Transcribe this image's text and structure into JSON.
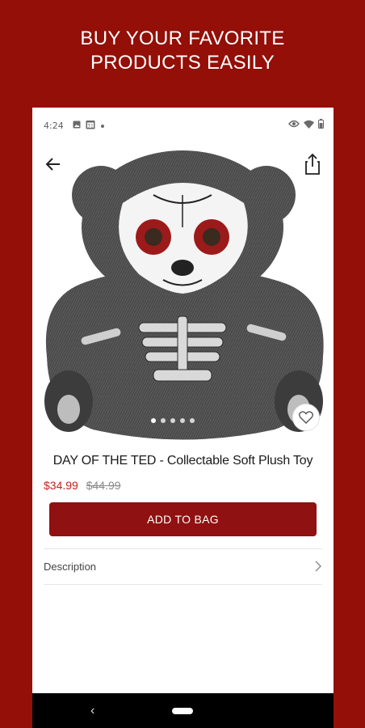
{
  "headline": {
    "line1": "BUY YOUR FAVORITE",
    "line2": "PRODUCTS EASILY"
  },
  "status_bar": {
    "time": "4:24",
    "icons": [
      "gallery-icon",
      "calendar-icon",
      "dot-icon",
      "eye-icon",
      "wifi-icon",
      "battery-icon"
    ]
  },
  "toolbar": {
    "back_icon": "arrow-left-icon",
    "share_icon": "share-icon"
  },
  "product": {
    "image_subject": "day-of-the-dead-teddy-bear",
    "title": "DAY OF THE TED - Collectable Soft Plush Toy",
    "sale_price": "$34.99",
    "original_price": "$44.99",
    "image_count": 5,
    "active_image_index": 0
  },
  "actions": {
    "add_to_bag_label": "ADD TO BAG",
    "favorite_icon": "heart-icon"
  },
  "details": {
    "description_label": "Description",
    "chevron_icon": "chevron-right-icon"
  },
  "nav_bar": {
    "back_glyph": "‹",
    "home_icon": "home-pill-icon"
  },
  "colors": {
    "brand_red": "#930f07",
    "button_red": "#8f1111",
    "sale_red": "#c81e1e"
  }
}
